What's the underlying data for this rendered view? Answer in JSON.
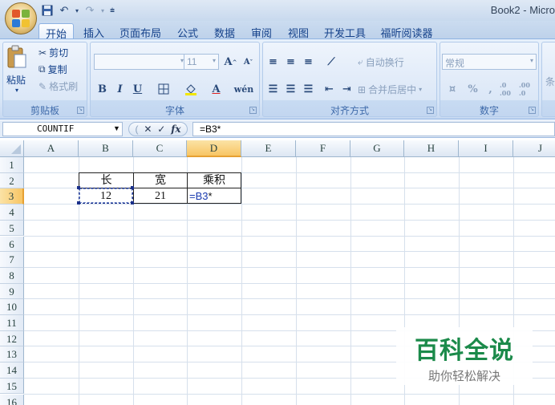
{
  "window": {
    "title": "Book2 - Micro"
  },
  "quick_access": {
    "icons": [
      "save-icon",
      "undo-icon",
      "redo-icon",
      "customize-icon"
    ]
  },
  "tabs": [
    {
      "label": "开始",
      "active": true
    },
    {
      "label": "插入"
    },
    {
      "label": "页面布局"
    },
    {
      "label": "公式"
    },
    {
      "label": "数据"
    },
    {
      "label": "审阅"
    },
    {
      "label": "视图"
    },
    {
      "label": "开发工具"
    },
    {
      "label": "福昕阅读器"
    }
  ],
  "ribbon": {
    "clipboard": {
      "label": "剪贴板",
      "paste": "粘贴",
      "cut": "剪切",
      "copy": "复制",
      "format_painter": "格式刷"
    },
    "font": {
      "label": "字体",
      "size": "11",
      "bold": "B",
      "italic": "I",
      "underline": "U",
      "grow": "A",
      "shrink": "A",
      "phonetic": "wén"
    },
    "alignment": {
      "label": "对齐方式",
      "wrap_text": "自动换行",
      "merge_center": "合并后居中"
    },
    "number": {
      "label": "数字",
      "format": "常规",
      "percent": "%",
      "comma": ",",
      "inc_decimal": ".0 .00",
      "dec_decimal": ".00 .0"
    },
    "styles": {
      "partial": "条"
    }
  },
  "formula_bar": {
    "name_box": "COUNTIF",
    "formula": "=B3*"
  },
  "sheet": {
    "columns": [
      "A",
      "B",
      "C",
      "D",
      "E",
      "F",
      "G",
      "H",
      "I",
      "J"
    ],
    "rows": [
      "1",
      "2",
      "3",
      "4",
      "5",
      "6",
      "7",
      "8",
      "9",
      "10",
      "11",
      "12",
      "13",
      "14",
      "15",
      "16"
    ],
    "cells": {
      "B2": "长",
      "C2": "宽",
      "D2": "乘积",
      "B3": "12",
      "C3": "21",
      "D3_ref": "=B3",
      "D3_op": "*"
    },
    "active_column": "D",
    "active_row": "3"
  },
  "watermark": {
    "title": "百科全说",
    "subtitle": "助你轻松解决"
  },
  "colors": {
    "ribbon_bg": "#dbe7f7",
    "accent": "#15428b",
    "selected_header": "#f8c564",
    "watermark_green": "#1b8a4a",
    "ref_blue": "#1a3bb0"
  }
}
